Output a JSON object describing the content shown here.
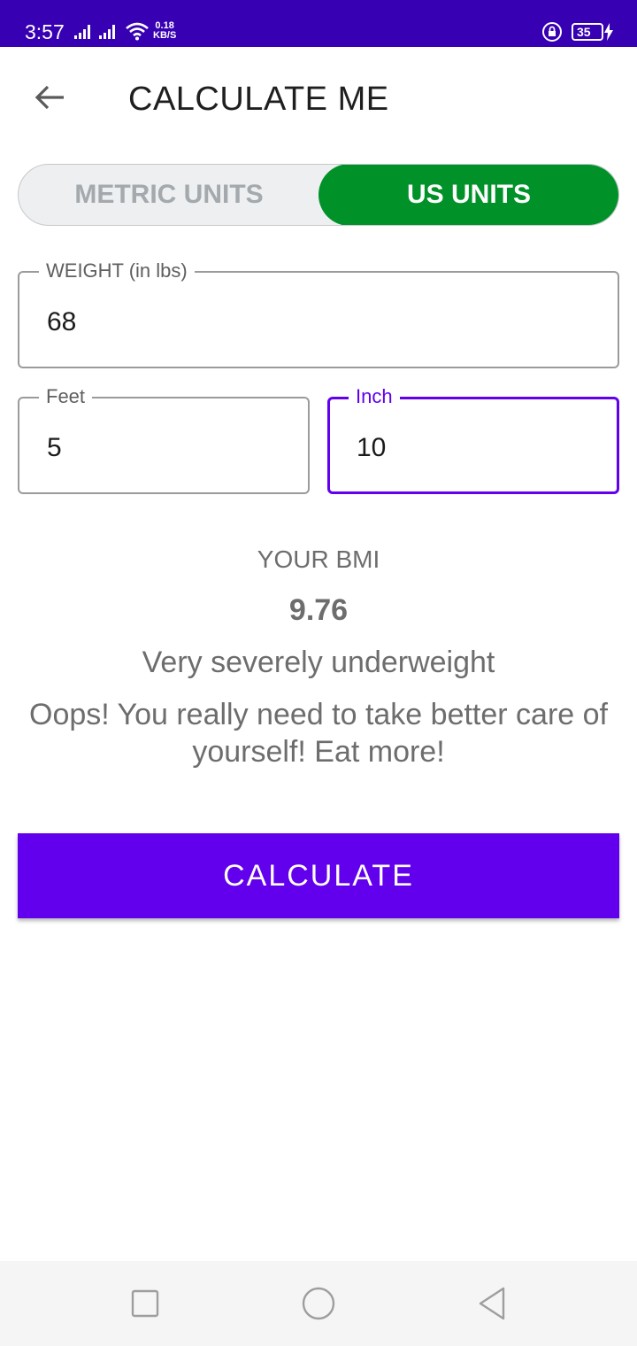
{
  "status_bar": {
    "time": "3:57",
    "net_speed_value": "0.18",
    "net_speed_unit": "KB/S",
    "battery": "35",
    "background": "#3700b3"
  },
  "toolbar": {
    "title": "CALCULATE ME",
    "back_icon": "arrow-back-icon"
  },
  "units_toggle": {
    "metric_label": "METRIC UNITS",
    "us_label": "US UNITS",
    "selected": "US UNITS",
    "selected_color": "#009229"
  },
  "form": {
    "weight": {
      "label": "WEIGHT (in lbs)",
      "value": "68"
    },
    "feet": {
      "label": "Feet",
      "value": "5"
    },
    "inch": {
      "label": "Inch",
      "value": "10"
    },
    "focus_color": "#6200ee"
  },
  "result": {
    "title": "YOUR BMI",
    "value": "9.76",
    "category": "Very severely underweight",
    "advice": "Oops! You really need to take better care of yourself! Eat more!"
  },
  "calculate_button": {
    "label": "CALCULATE",
    "color": "#6200ee"
  },
  "nav_bar": {
    "recent_icon": "square-recents-icon",
    "home_icon": "circle-home-icon",
    "back_icon": "triangle-back-icon"
  }
}
